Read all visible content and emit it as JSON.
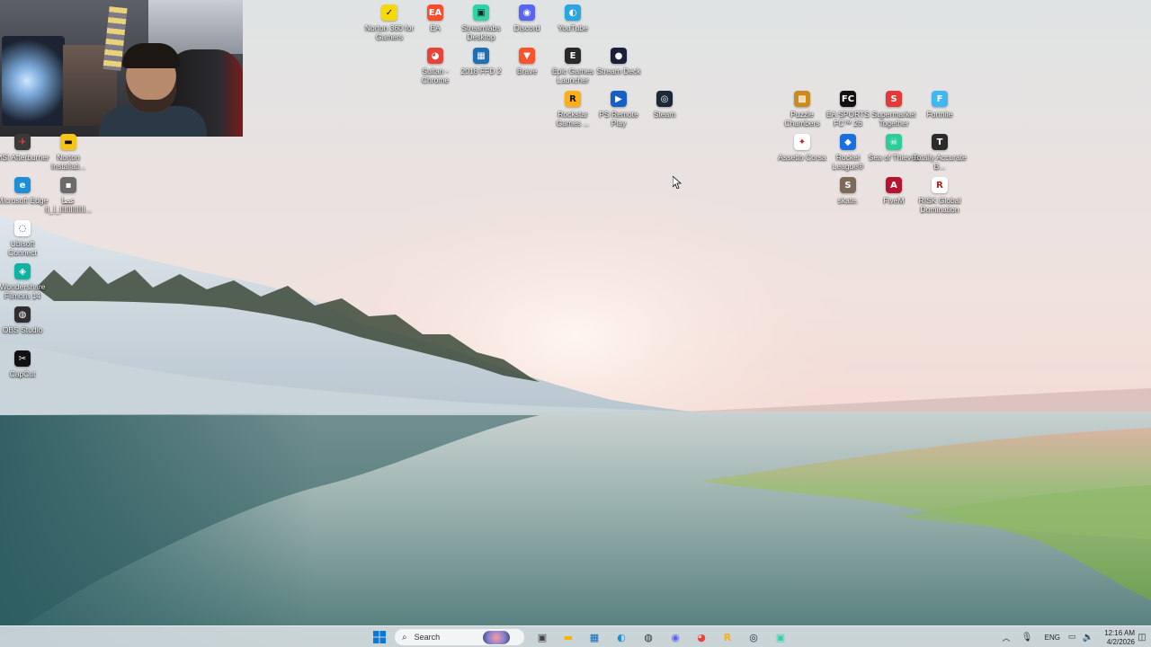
{
  "desktop": {
    "icons": [
      {
        "id": "norton360",
        "label": "Norton 360 for Gamers",
        "glyph": "✓",
        "color": "#f5d90a",
        "fg": "#111",
        "icon_name": "norton-icon"
      },
      {
        "id": "ea",
        "label": "EA",
        "glyph": "EA",
        "color": "#ff4b2b",
        "fg": "#fff",
        "icon_name": "ea-icon"
      },
      {
        "id": "streamlabs",
        "label": "Streamlabs Desktop",
        "glyph": "▣",
        "color": "#2fd3a5",
        "fg": "#0a2a22",
        "icon_name": "streamlabs-icon"
      },
      {
        "id": "discord",
        "label": "Discord",
        "glyph": "◉",
        "color": "#5865f2",
        "fg": "#fff",
        "icon_name": "discord-icon"
      },
      {
        "id": "youtube",
        "label": "YouTube",
        "glyph": "◐",
        "color": "#2aa7e0",
        "fg": "#fff",
        "icon_name": "youtube-edge-icon"
      },
      {
        "id": "sultan",
        "label": "Sultan - Chrome",
        "glyph": "◕",
        "color": "#e8433a",
        "fg": "#fff",
        "icon_name": "chrome-icon"
      },
      {
        "id": "2018ffd",
        "label": "2018 FFD 2",
        "glyph": "▦",
        "color": "#1f6fb5",
        "fg": "#fff",
        "icon_name": "shortcut-icon"
      },
      {
        "id": "brave",
        "label": "Brave",
        "glyph": "▼",
        "color": "#fb542b",
        "fg": "#fff",
        "icon_name": "brave-icon"
      },
      {
        "id": "epic",
        "label": "Epic Games Launcher",
        "glyph": "E",
        "color": "#2a2a2a",
        "fg": "#fff",
        "icon_name": "epic-games-icon"
      },
      {
        "id": "streamdeck",
        "label": "Stream Deck",
        "glyph": "●",
        "color": "#1b1f3a",
        "fg": "#fff",
        "icon_name": "stream-deck-icon"
      },
      {
        "id": "rockstar",
        "label": "Rockstar Games ...",
        "glyph": "R",
        "color": "#fcaf17",
        "fg": "#111",
        "icon_name": "rockstar-icon"
      },
      {
        "id": "psremote",
        "label": "PS Remote Play",
        "glyph": "▶",
        "color": "#1560c4",
        "fg": "#fff",
        "icon_name": "ps-remote-play-icon"
      },
      {
        "id": "steam",
        "label": "Steam",
        "glyph": "◎",
        "color": "#1b2838",
        "fg": "#fff",
        "icon_name": "steam-icon"
      },
      {
        "id": "puzzle",
        "label": "Puzzle Chambers",
        "glyph": "▩",
        "color": "#c98a1e",
        "fg": "#fff",
        "icon_name": "game-icon"
      },
      {
        "id": "eafc",
        "label": "EA SPORTS FC™ 26",
        "glyph": "FC",
        "color": "#111111",
        "fg": "#fff",
        "icon_name": "ea-fc-icon"
      },
      {
        "id": "supermarket",
        "label": "Supermarket Together",
        "glyph": "S",
        "color": "#e53935",
        "fg": "#fff",
        "icon_name": "game-icon"
      },
      {
        "id": "fortnite",
        "label": "Fortnite",
        "glyph": "F",
        "color": "#3fb7f0",
        "fg": "#fff",
        "icon_name": "fortnite-icon"
      },
      {
        "id": "assetto",
        "label": "Assetto Corsa",
        "glyph": "✦",
        "color": "#ffffff",
        "fg": "#c62828",
        "icon_name": "assetto-corsa-icon"
      },
      {
        "id": "rocketleague",
        "label": "Rocket League®",
        "glyph": "◆",
        "color": "#1a6fe0",
        "fg": "#fff",
        "icon_name": "rocket-league-icon"
      },
      {
        "id": "seaofthieves",
        "label": "Sea of Thieves",
        "glyph": "☠",
        "color": "#2ecc9a",
        "fg": "#fff",
        "icon_name": "sea-of-thieves-icon"
      },
      {
        "id": "totallyaccurate",
        "label": "Totally Accurate B...",
        "glyph": "T",
        "color": "#2b2b2b",
        "fg": "#fff",
        "icon_name": "game-icon"
      },
      {
        "id": "skate",
        "label": "skate.",
        "glyph": "S",
        "color": "#7c6a58",
        "fg": "#fff",
        "icon_name": "skate-icon"
      },
      {
        "id": "fivem",
        "label": "FiveM",
        "glyph": "A",
        "color": "#b5132f",
        "fg": "#fff",
        "icon_name": "fivem-icon"
      },
      {
        "id": "risk",
        "label": "RISK Global Domination",
        "glyph": "R",
        "color": "#ffffff",
        "fg": "#b71c1c",
        "icon_name": "risk-icon"
      },
      {
        "id": "msiafterburner",
        "label": "MSI Afterburner",
        "glyph": "✈",
        "color": "#3a3a3a",
        "fg": "#ff3b3b",
        "icon_name": "msi-afterburner-icon"
      },
      {
        "id": "norton-install",
        "label": "Norton Installati...",
        "glyph": "▬",
        "color": "#f5c518",
        "fg": "#111",
        "icon_name": "folder-icon"
      },
      {
        "id": "edge",
        "label": "Microsoft Edge",
        "glyph": "e",
        "color": "#1e8fd6",
        "fg": "#fff",
        "icon_name": "edge-icon"
      },
      {
        "id": "arabic",
        "label": "ﻋﺼﺎ ﺍﺍﺍﺍﺍﺍﺍﺍﺍﺍﺍﺍ_ﺍ_ﺍﺍ...",
        "glyph": "▪",
        "color": "#6b6b6b",
        "fg": "#fff",
        "icon_name": "file-icon"
      },
      {
        "id": "ubisoft",
        "label": "Ubisoft Connect",
        "glyph": "◌",
        "color": "#ffffff",
        "fg": "#1b3fa0",
        "icon_name": "ubisoft-icon"
      },
      {
        "id": "filmora",
        "label": "Wondershare Filmora 14",
        "glyph": "◈",
        "color": "#0fb3a4",
        "fg": "#fff",
        "icon_name": "filmora-icon"
      },
      {
        "id": "obs",
        "label": "OBS Studio",
        "glyph": "◍",
        "color": "#302e31",
        "fg": "#fff",
        "icon_name": "obs-icon"
      },
      {
        "id": "capcut",
        "label": "CapCut",
        "glyph": "✂",
        "color": "#111111",
        "fg": "#fff",
        "icon_name": "capcut-icon"
      }
    ]
  },
  "taskbar": {
    "search_placeholder": "Search",
    "pinned": [
      {
        "name": "task-view-icon",
        "glyph": "▣",
        "color": "#444"
      },
      {
        "name": "file-explorer-icon",
        "glyph": "▬",
        "color": "#f2b705"
      },
      {
        "name": "microsoft-store-icon",
        "glyph": "▦",
        "color": "#0a67c2"
      },
      {
        "name": "edge-taskbar-icon",
        "glyph": "◐",
        "color": "#1e8fd6"
      },
      {
        "name": "obs-taskbar-icon",
        "glyph": "◍",
        "color": "#333"
      },
      {
        "name": "discord-taskbar-icon",
        "glyph": "◉",
        "color": "#5865f2"
      },
      {
        "name": "chrome-taskbar-icon",
        "glyph": "◕",
        "color": "#e8433a"
      },
      {
        "name": "rockstar-taskbar-icon",
        "glyph": "R",
        "color": "#fcaf17"
      },
      {
        "name": "steam-taskbar-icon",
        "glyph": "◎",
        "color": "#1b2838"
      },
      {
        "name": "streamlabs-taskbar-icon",
        "glyph": "▣",
        "color": "#2fd3a5"
      }
    ],
    "tray": {
      "language": "ENG",
      "time": "12:16 AM",
      "date": "4/2/2026"
    }
  }
}
